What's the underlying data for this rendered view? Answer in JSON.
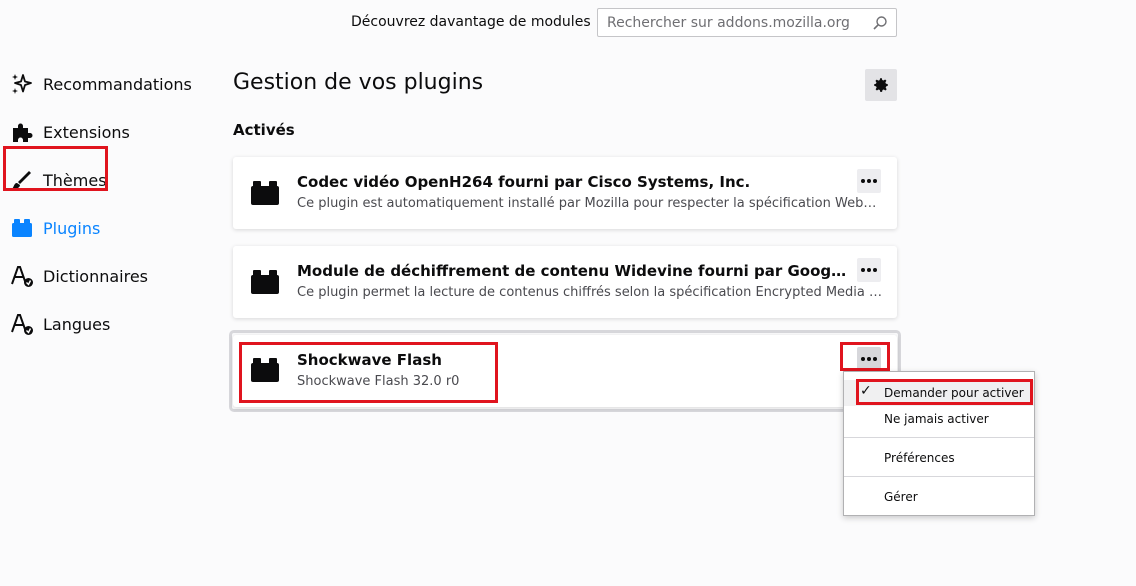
{
  "header": {
    "discover_label": "Découvrez davantage de modules",
    "search_placeholder": "Rechercher sur addons.mozilla.org"
  },
  "sidebar": {
    "items": [
      {
        "label": "Recommandations",
        "icon": "sparkle-icon"
      },
      {
        "label": "Extensions",
        "icon": "puzzle-icon"
      },
      {
        "label": "Thèmes",
        "icon": "brush-icon"
      },
      {
        "label": "Plugins",
        "icon": "plugin-icon",
        "active": true
      },
      {
        "label": "Dictionnaires",
        "icon": "dictionary-icon"
      },
      {
        "label": "Langues",
        "icon": "language-icon"
      }
    ]
  },
  "main": {
    "title": "Gestion de vos plugins",
    "section_title": "Activés",
    "plugins": [
      {
        "name": "Codec vidéo OpenH264 fourni par Cisco Systems, Inc.",
        "description": "Ce plugin est automatiquement installé par Mozilla pour respecter la spécification WebRTC"
      },
      {
        "name": "Module de déchiffrement de contenu Widevine fourni par Google Inc.",
        "description": "Ce plugin permet la lecture de contenus chiffrés selon la spécification Encrypted Media Extensions"
      },
      {
        "name": "Shockwave Flash",
        "description": "Shockwave Flash 32.0 r0"
      }
    ]
  },
  "menu": {
    "items": [
      {
        "label": "Demander pour activer",
        "checked": true
      },
      {
        "label": "Ne jamais activer"
      },
      {
        "label": "Préférences"
      },
      {
        "label": "Gérer"
      }
    ]
  },
  "colors": {
    "accent": "#0a84ff",
    "highlight": "#e0141e"
  }
}
